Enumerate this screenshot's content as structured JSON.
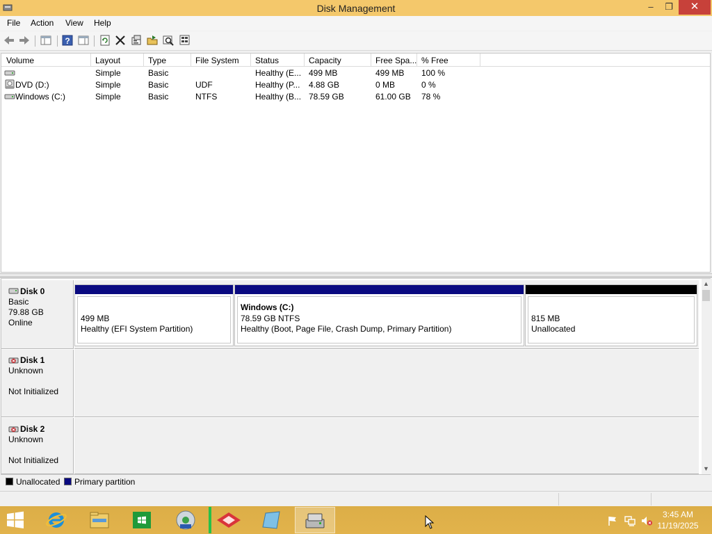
{
  "window": {
    "title": "Disk Management",
    "buttons": {
      "minimize": "–",
      "restore": "❐",
      "close": "✕"
    }
  },
  "menu": [
    "File",
    "Action",
    "View",
    "Help"
  ],
  "toolbar": [
    "back-arrow-icon",
    "forward-arrow-icon",
    "console-tree-icon",
    "help-icon",
    "properties-pane-icon",
    "refresh-icon",
    "delete-icon",
    "properties-icon",
    "open-icon",
    "explore-icon",
    "rescan-icon"
  ],
  "volume_table": {
    "columns": [
      "Volume",
      "Layout",
      "Type",
      "File System",
      "Status",
      "Capacity",
      "Free Spa...",
      "% Free"
    ],
    "rows": [
      {
        "volume": "",
        "layout": "Simple",
        "type": "Basic",
        "fs": "",
        "status": "Healthy (E...",
        "capacity": "499 MB",
        "free": "499 MB",
        "pct": "100 %",
        "icon": "drive-icon"
      },
      {
        "volume": "DVD (D:)",
        "layout": "Simple",
        "type": "Basic",
        "fs": "UDF",
        "status": "Healthy (P...",
        "capacity": "4.88 GB",
        "free": "0 MB",
        "pct": "0 %",
        "icon": "dvd-drive-icon"
      },
      {
        "volume": "Windows (C:)",
        "layout": "Simple",
        "type": "Basic",
        "fs": "NTFS",
        "status": "Healthy (B...",
        "capacity": "78.59 GB",
        "free": "61.00 GB",
        "pct": "78 %",
        "icon": "drive-icon"
      }
    ]
  },
  "disks": [
    {
      "name": "Disk 0",
      "type": "Basic",
      "size": "79.88 GB",
      "state": "Online",
      "partitions": [
        {
          "title": "",
          "line1": "499 MB",
          "line2": "Healthy (EFI System Partition)",
          "kind": "primary"
        },
        {
          "title": "Windows  (C:)",
          "line1": "78.59 GB NTFS",
          "line2": "Healthy (Boot, Page File, Crash Dump, Primary Partition)",
          "kind": "primary"
        },
        {
          "title": "",
          "line1": "815 MB",
          "line2": "Unallocated",
          "kind": "unallocated"
        }
      ]
    },
    {
      "name": "Disk 1",
      "type": "Unknown",
      "state": "Not Initialized"
    },
    {
      "name": "Disk 2",
      "type": "Unknown",
      "state": "Not Initialized"
    }
  ],
  "legend": [
    {
      "label": "Unallocated",
      "color": "#000000"
    },
    {
      "label": "Primary partition",
      "color": "#0a0a80"
    }
  ],
  "colors": {
    "primary": "#0a0a80",
    "unallocated": "#000000",
    "titlebar": "#f4c86b",
    "taskbar": "#dcae47"
  },
  "taskbar": {
    "apps": [
      "internet-explorer-icon",
      "file-explorer-icon",
      "store-icon",
      "media-center-icon",
      "app-red-icon",
      "app-blue-icon",
      "disk-management-icon"
    ],
    "tray": [
      "flag-icon",
      "network-icon",
      "volume-muted-icon"
    ],
    "time": "3:45 AM",
    "date": "11/19/2025"
  }
}
